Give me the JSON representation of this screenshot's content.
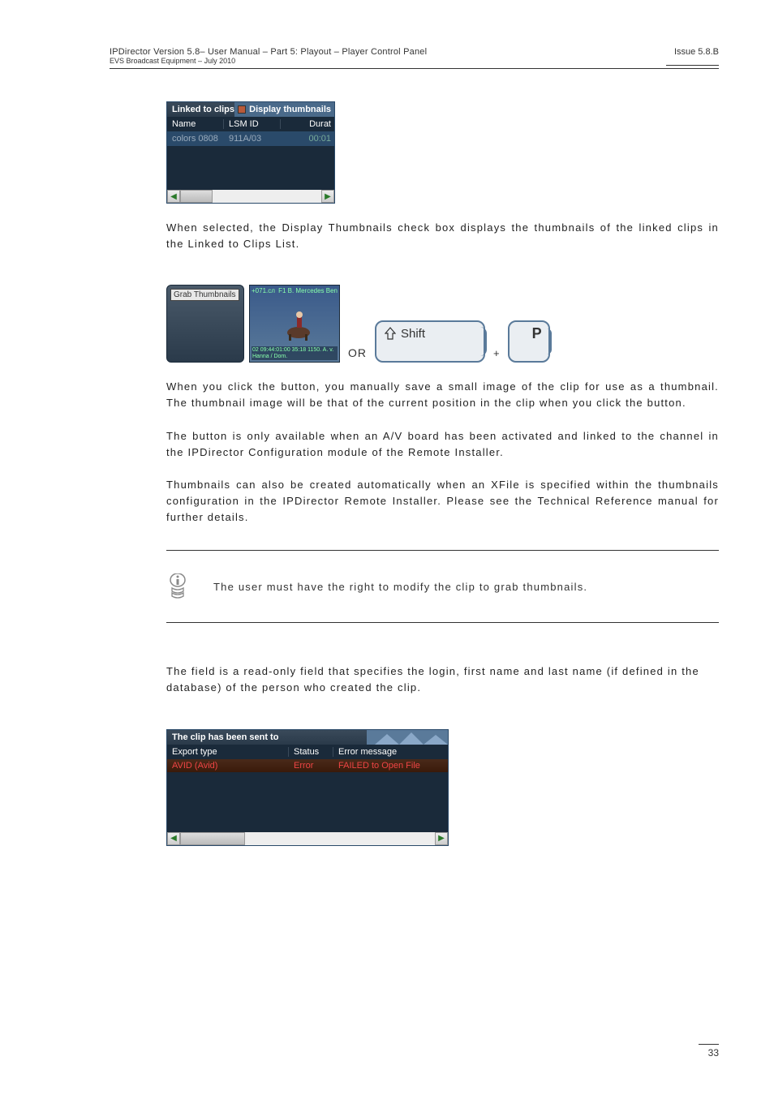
{
  "header": {
    "left": "IPDirector Version 5.8– User Manual – Part 5: Playout – Player Control Panel",
    "sub": "EVS Broadcast Equipment – July 2010",
    "right": "Issue 5.8.B"
  },
  "panel1": {
    "title_left": "Linked to clips",
    "title_right": "Display thumbnails",
    "columns": {
      "c1": "Name",
      "c2": "LSM ID",
      "c3": "Durat"
    },
    "row": {
      "c1": "colors 0808",
      "c2": "911A/03",
      "c3": "00:01"
    }
  },
  "para1": "When selected, the Display Thumbnails check box displays the thumbnails of the linked clips in the Linked to Clips List.",
  "fig": {
    "grab_label": "Grab Thumbnails",
    "thumb_top_left": "+071.cл",
    "thumb_top_right": "F1 B. Mercedes Ben",
    "thumb_bottom": "02 09:44:01:00 35:18 1150.\nA. v. Hanna / Dom.",
    "or": "OR",
    "shift": "Shift",
    "plus": "+",
    "p": "P"
  },
  "para2": "When you click the                      button, you manually save a small image of the clip for use as a thumbnail. The thumbnail image will be that of the current position in the clip when you click the                     button.",
  "para3": "The                     button is only available when an A/V board has been activated and linked to the channel in the IPDirector Configuration module of the Remote Installer.",
  "para4": "Thumbnails can also be created automatically when an XFile is specified within the thumbnails configuration in the IPDirector Remote Installer. Please see the Technical Reference manual for further details.",
  "note": "The user must have the right to modify the clip to grab thumbnails.",
  "para5": "The          field is a read-only field that specifies the login, first name and last name (if defined in the database) of the person who created the clip.",
  "panel2": {
    "title": "The clip has been sent to",
    "columns": {
      "c1": "Export type",
      "c2": "Status",
      "c3": "Error message"
    },
    "row": {
      "c1": "AVID (Avid)",
      "c2": "Error",
      "c3": "FAILED to Open File"
    }
  },
  "page_number": "33"
}
